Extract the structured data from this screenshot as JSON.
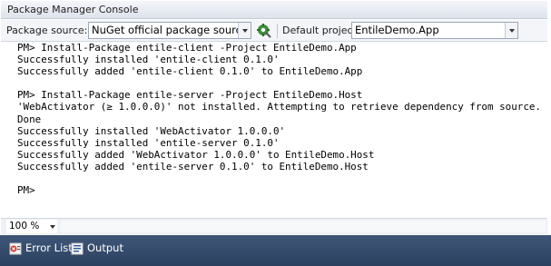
{
  "window": {
    "title": "Package Manager Console"
  },
  "toolbar": {
    "package_source_label": "Package source:",
    "package_source_value": "NuGet official package source",
    "settings_icon": "gear-icon",
    "default_project_label": "Default project:",
    "default_project_value": "EntileDemo.App"
  },
  "console": {
    "lines": [
      "PM> Install-Package entile-client -Project EntileDemo.App",
      "Successfully installed 'entile-client 0.1.0'",
      "Successfully added 'entile-client 0.1.0' to EntileDemo.App",
      "",
      "PM> Install-Package entile-server -Project EntileDemo.Host",
      "'WebActivator (≥ 1.0.0.0)' not installed. Attempting to retrieve dependency from source...",
      "Done",
      "Successfully installed 'WebActivator 1.0.0.0'",
      "Successfully installed 'entile-server 0.1.0'",
      "Successfully added 'WebActivator 1.0.0.0' to EntileDemo.Host",
      "Successfully added 'entile-server 0.1.0' to EntileDemo.Host",
      "",
      "PM>"
    ]
  },
  "statusbar": {
    "zoom": "100 %"
  },
  "tabs": [
    {
      "label": "Error List",
      "icon": "error-list-icon"
    },
    {
      "label": "Output",
      "icon": "output-icon"
    }
  ],
  "colors": {
    "tab_bar": "#3a5276",
    "accent_green": "#3f8d3c"
  }
}
